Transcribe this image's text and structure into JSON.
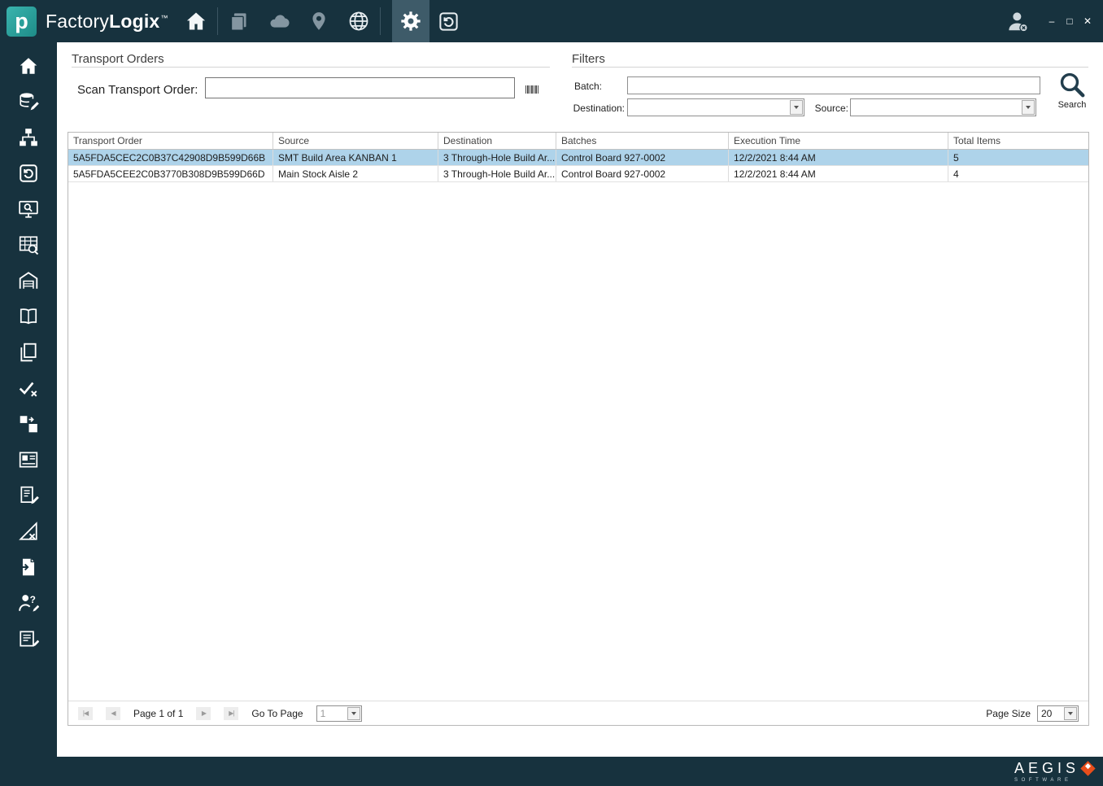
{
  "colors": {
    "chrome": "#17323e",
    "active_tile": "#3e5b69",
    "accent_teal": "#2aa7a2",
    "selected_row": "#aed3ea",
    "brand_orange": "#e84e1b"
  },
  "titlebar": {
    "logo_letter": "p",
    "brand_prefix": "Factory",
    "brand_suffix": "Logix",
    "trademark": "™",
    "icons": [
      "home-icon",
      "documents-icon",
      "cloud-icon",
      "location-pin-icon",
      "globe-icon",
      "settings-gear-icon",
      "history-icon",
      "user-account-icon"
    ],
    "window": {
      "minimize": "–",
      "maximize": "□",
      "close": "✕"
    }
  },
  "sidebar": {
    "items": [
      {
        "icon": "home-icon"
      },
      {
        "icon": "database-edit-icon"
      },
      {
        "icon": "workflow-icon"
      },
      {
        "icon": "history-icon"
      },
      {
        "icon": "monitor-search-icon"
      },
      {
        "icon": "table-search-icon"
      },
      {
        "icon": "warehouse-icon"
      },
      {
        "icon": "book-icon"
      },
      {
        "icon": "copy-icon"
      },
      {
        "icon": "verify-icon"
      },
      {
        "icon": "transfer-icon"
      },
      {
        "icon": "id-card-icon"
      },
      {
        "icon": "document-edit-icon"
      },
      {
        "icon": "design-cancel-icon"
      },
      {
        "icon": "document-import-icon"
      },
      {
        "icon": "user-help-icon"
      },
      {
        "icon": "schedule-edit-icon"
      }
    ]
  },
  "transport": {
    "title": "Transport Orders",
    "scan_label": "Scan Transport Order:",
    "scan_value": ""
  },
  "filters": {
    "title": "Filters",
    "batch_label": "Batch:",
    "batch_value": "",
    "destination_label": "Destination:",
    "destination_value": "",
    "source_label": "Source:",
    "source_value": "",
    "search_label": "Search"
  },
  "table": {
    "columns": [
      "Transport Order",
      "Source",
      "Destination",
      "Batches",
      "Execution Time",
      "Total Items"
    ],
    "rows": [
      {
        "transport_order": "5A5FDA5CEC2C0B37C42908D9B599D66B",
        "source": "SMT Build Area KANBAN 1",
        "destination": "3 Through-Hole Build Ar...",
        "batches": "Control Board 927-0002",
        "execution_time": "12/2/2021 8:44 AM",
        "total_items": "5",
        "selected": true
      },
      {
        "transport_order": "5A5FDA5CEE2C0B3770B308D9B599D66D",
        "source": "Main Stock Aisle 2",
        "destination": "3 Through-Hole Build Ar...",
        "batches": "Control Board 927-0002",
        "execution_time": "12/2/2021 8:44 AM",
        "total_items": "4",
        "selected": false
      }
    ]
  },
  "pagination": {
    "first_glyph": "|◀",
    "prev_glyph": "◀",
    "page_label": "Page 1 of 1",
    "next_glyph": "▶",
    "last_glyph": "▶|",
    "goto_label": "Go To Page",
    "goto_value": "1",
    "page_size_label": "Page Size",
    "page_size_value": "20"
  },
  "footer": {
    "brand": "AEGIS",
    "tagline": "SOFTWARE"
  }
}
